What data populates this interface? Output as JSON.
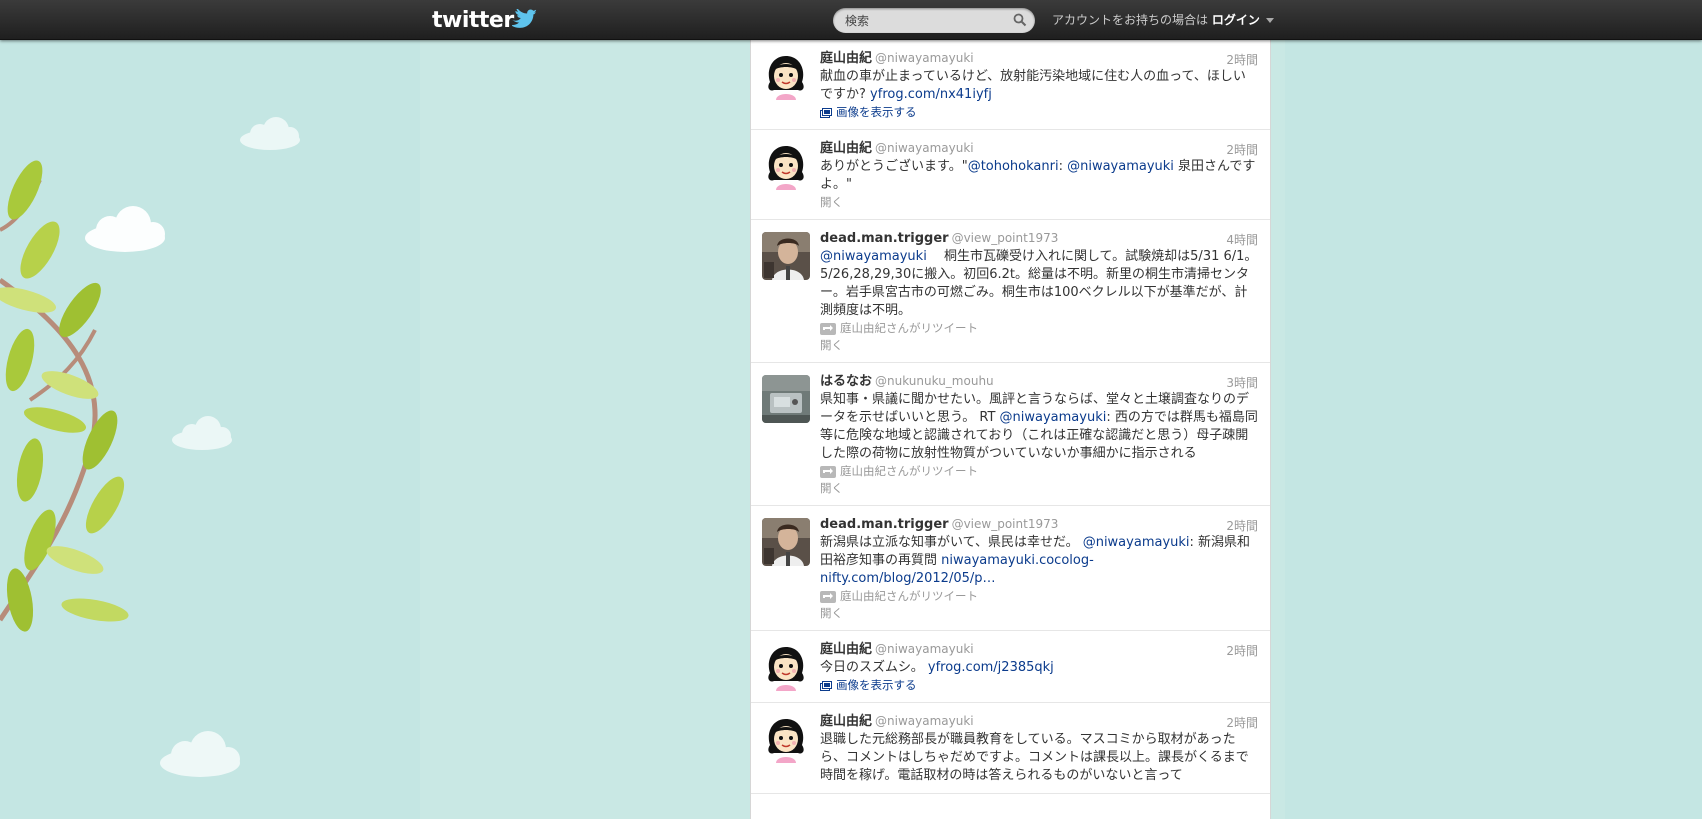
{
  "header": {
    "logo_text": "twitter",
    "search_placeholder": "検索",
    "login_prefix": "アカウントをお持ちの場合は",
    "login_label": "ログイン"
  },
  "tweets": [
    {
      "name": "庭山由紀",
      "handle": "@niwayamayuki",
      "time": "2時間",
      "avatar": "cartoon-girl",
      "segments": [
        {
          "t": "献血の車が止まっているけど、放射能汚染地域に住む人の血って、ほしいですか? ",
          "link": false
        },
        {
          "t": "yfrog.com/nx41iyfj",
          "link": true
        }
      ],
      "action": "画像を表示する"
    },
    {
      "name": "庭山由紀",
      "handle": "@niwayamayuki",
      "time": "2時間",
      "avatar": "cartoon-girl",
      "segments": [
        {
          "t": "ありがとうございます。\"",
          "link": false
        },
        {
          "t": "@tohohokanri",
          "link": true
        },
        {
          "t": ": ",
          "link": false
        },
        {
          "t": "@niwayamayuki",
          "link": true
        },
        {
          "t": " 泉田さんですよ。\"",
          "link": false
        }
      ],
      "open": "開く"
    },
    {
      "name": "dead.man.trigger",
      "handle": "@view_point1973",
      "time": "4時間",
      "avatar": "photo-man",
      "segments": [
        {
          "t": "@niwayamayuki",
          "link": true
        },
        {
          "t": "　 桐生市瓦礫受け入れに関して。試験焼却は5/31 6/1。5/26,28,29,30に搬入。初回6.2t。総量は不明。新里の桐生市清掃センター。岩手県宮古市の可燃ごみ。桐生市は100ベクレル以下が基準だが、計測頻度は不明。",
          "link": false
        }
      ],
      "retweet": "庭山由紀さんがリツイート",
      "open": "開く"
    },
    {
      "name": "はるなお",
      "handle": "@nukunuku_mouhu",
      "time": "3時間",
      "avatar": "photo-device",
      "segments": [
        {
          "t": "県知事・県議に聞かせたい。風評と言うならば、堂々と土壌調査なりのデータを示せばいいと思う。 RT ",
          "link": false
        },
        {
          "t": "@niwayamayuki",
          "link": true
        },
        {
          "t": ": 西の方では群馬も福島同等に危険な地域と認識されており（これは正確な認識だと思う）母子疎開した際の荷物に放射性物質がついていないか事細かに指示される",
          "link": false
        }
      ],
      "retweet": "庭山由紀さんがリツイート",
      "open": "開く"
    },
    {
      "name": "dead.man.trigger",
      "handle": "@view_point1973",
      "time": "2時間",
      "avatar": "photo-man",
      "segments": [
        {
          "t": "新潟県は立派な知事がいて、県民は幸せだ。 ",
          "link": false
        },
        {
          "t": "@niwayamayuki",
          "link": true
        },
        {
          "t": ": 新潟県和田裕彦知事の再質問 ",
          "link": false
        },
        {
          "t": "niwayamayuki.cocolog-nifty.com/blog/2012/05/p…",
          "link": true
        }
      ],
      "retweet": "庭山由紀さんがリツイート",
      "open": "開く"
    },
    {
      "name": "庭山由紀",
      "handle": "@niwayamayuki",
      "time": "2時間",
      "avatar": "cartoon-girl",
      "segments": [
        {
          "t": "今日のスズムシ。 ",
          "link": false
        },
        {
          "t": "yfrog.com/j2385qkj",
          "link": true
        }
      ],
      "action": "画像を表示する"
    },
    {
      "name": "庭山由紀",
      "handle": "@niwayamayuki",
      "time": "2時間",
      "avatar": "cartoon-girl",
      "segments": [
        {
          "t": "退職した元総務部長が職員教育をしている。マスコミから取材があったら、コメントはしちゃだめですよ。コメントは課長以上。課長がくるまで時間を稼げ。電話取材の時は答えられるものがいないと言って",
          "link": false
        }
      ]
    }
  ]
}
